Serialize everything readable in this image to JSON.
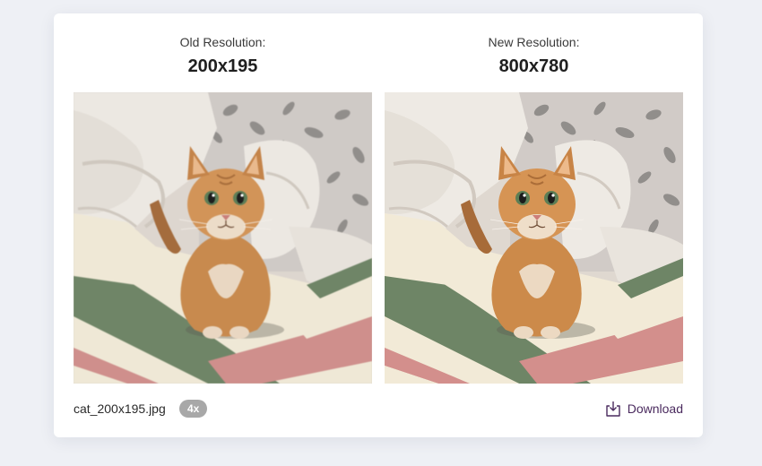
{
  "old": {
    "label": "Old Resolution:",
    "value": "200x195"
  },
  "new": {
    "label": "New Resolution:",
    "value": "800x780"
  },
  "footer": {
    "filename": "cat_200x195.jpg",
    "scale_badge": "4x",
    "download_label": "Download"
  },
  "colors": {
    "accent": "#4a2a5e",
    "badge_bg": "#a8a8a8"
  },
  "icons": {
    "download": "download-icon"
  }
}
